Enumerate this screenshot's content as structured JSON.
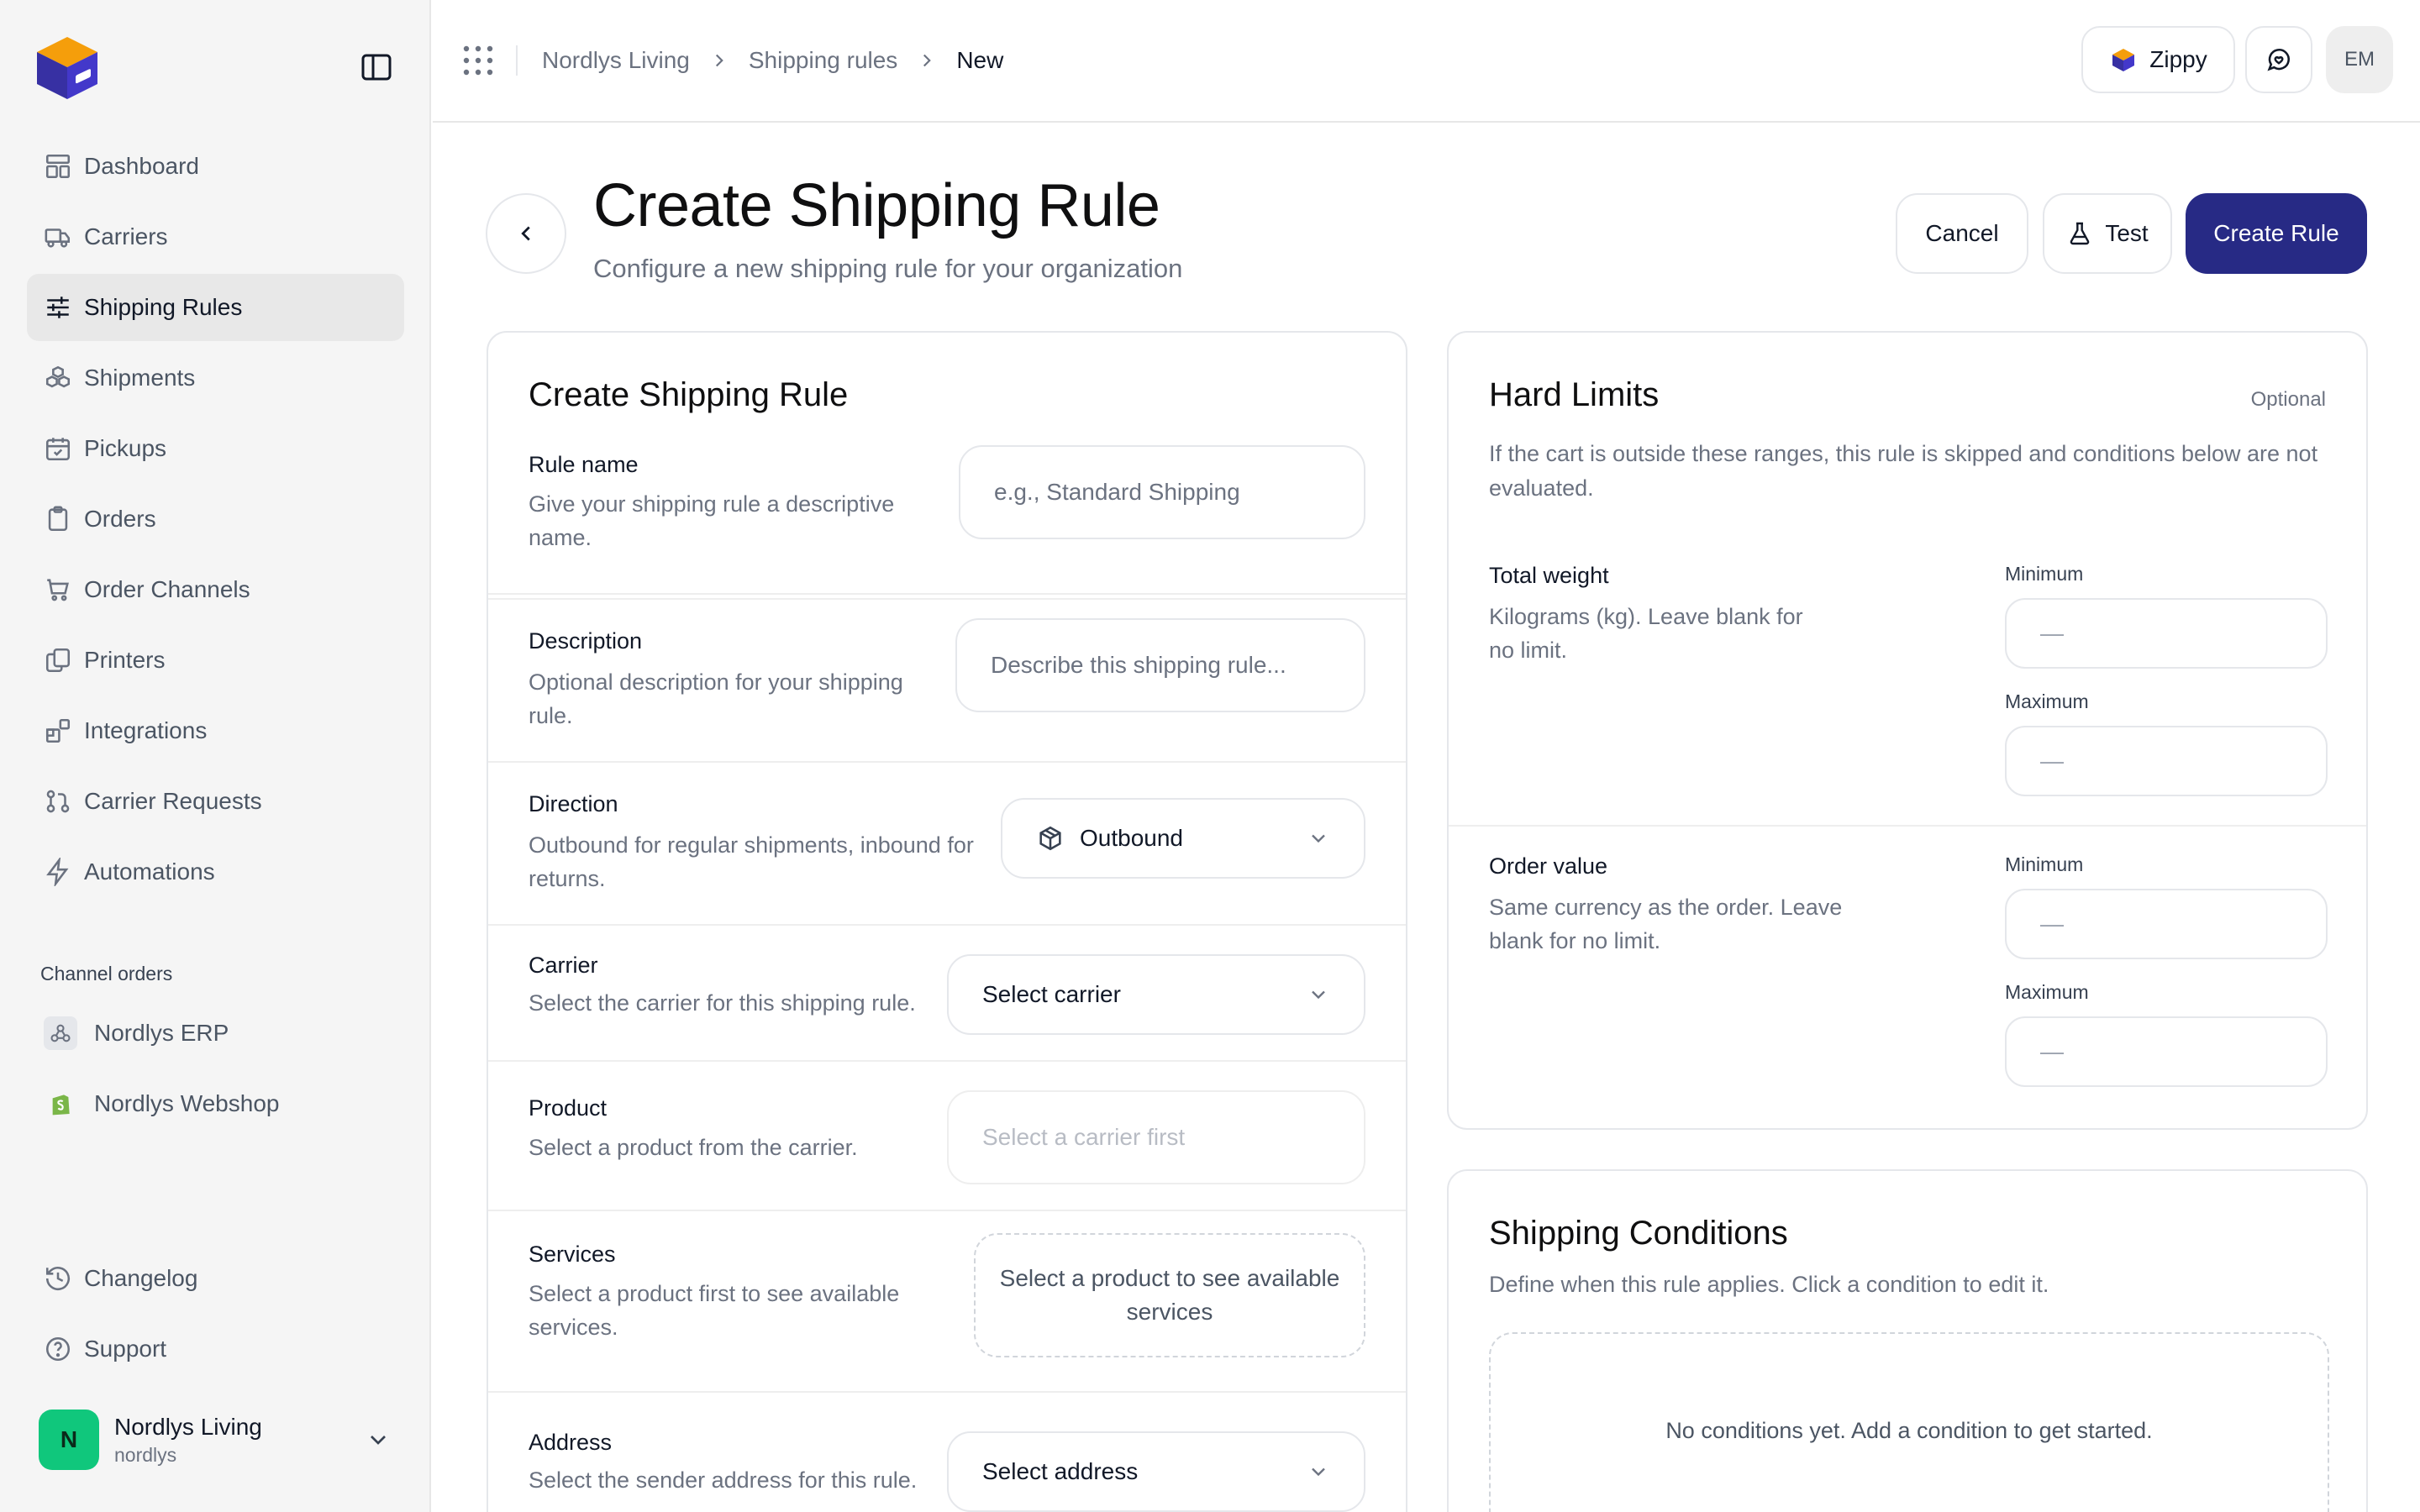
{
  "colors": {
    "primary": "#272a85",
    "sidebar_bg": "#f5f5f5",
    "active_bg": "#e8e8e8",
    "org_avatar": "#10c77c",
    "logo_orange": "#f59e0b",
    "logo_navy": "#3730a3"
  },
  "sidebar": {
    "nav": [
      {
        "label": "Dashboard",
        "icon": "layout-dashboard-icon",
        "active": false
      },
      {
        "label": "Carriers",
        "icon": "truck-icon",
        "active": false
      },
      {
        "label": "Shipping Rules",
        "icon": "sliders-icon",
        "active": true
      },
      {
        "label": "Shipments",
        "icon": "boxes-icon",
        "active": false
      },
      {
        "label": "Pickups",
        "icon": "calendar-check-icon",
        "active": false
      },
      {
        "label": "Orders",
        "icon": "clipboard-icon",
        "active": false
      },
      {
        "label": "Order Channels",
        "icon": "shopping-cart-icon",
        "active": false
      },
      {
        "label": "Printers",
        "icon": "copy-icon",
        "active": false
      },
      {
        "label": "Integrations",
        "icon": "blocks-icon",
        "active": false
      },
      {
        "label": "Carrier Requests",
        "icon": "git-pull-request-icon",
        "active": false
      },
      {
        "label": "Automations",
        "icon": "zap-icon",
        "active": false
      }
    ],
    "channel_section_label": "Channel orders",
    "channels": [
      {
        "label": "Nordlys ERP",
        "icon": "webhook-icon"
      },
      {
        "label": "Nordlys Webshop",
        "icon": "shopify-icon"
      }
    ],
    "bottom": [
      {
        "label": "Changelog",
        "icon": "history-icon"
      },
      {
        "label": "Support",
        "icon": "help-circle-icon"
      }
    ],
    "org": {
      "initial": "N",
      "name": "Nordlys Living",
      "slug": "nordlys"
    }
  },
  "topbar": {
    "breadcrumb": [
      "Nordlys Living",
      "Shipping rules",
      "New"
    ],
    "zippy_label": "Zippy",
    "user_initials": "EM"
  },
  "header": {
    "title": "Create Shipping Rule",
    "subtitle": "Configure a new shipping rule for your organization",
    "cancel_label": "Cancel",
    "test_label": "Test",
    "create_label": "Create Rule"
  },
  "form": {
    "title": "Create Shipping Rule",
    "rule_name": {
      "label": "Rule name",
      "desc": "Give your shipping rule a descriptive name.",
      "placeholder": "e.g., Standard Shipping"
    },
    "description": {
      "label": "Description",
      "desc": "Optional description for your shipping rule.",
      "placeholder": "Describe this shipping rule..."
    },
    "direction": {
      "label": "Direction",
      "desc": "Outbound for regular shipments, inbound for returns.",
      "value": "Outbound"
    },
    "carrier": {
      "label": "Carrier",
      "desc": "Select the carrier for this shipping rule.",
      "placeholder": "Select carrier"
    },
    "product": {
      "label": "Product",
      "desc": "Select a product from the carrier.",
      "placeholder": "Select a carrier first"
    },
    "services": {
      "label": "Services",
      "desc": "Select a product first to see available services.",
      "placeholder": "Select a product to see available services"
    },
    "address": {
      "label": "Address",
      "desc": "Select the sender address for this rule.",
      "placeholder": "Select address"
    }
  },
  "limits": {
    "title": "Hard Limits",
    "optional": "Optional",
    "desc": "If the cart is outside these ranges, this rule is skipped and conditions below are not evaluated.",
    "weight": {
      "label": "Total weight",
      "desc": "Kilograms (kg). Leave blank for no limit.",
      "min_label": "Minimum",
      "max_label": "Maximum",
      "min_placeholder": "—",
      "max_placeholder": "—"
    },
    "order_value": {
      "label": "Order value",
      "desc": "Same currency as the order. Leave blank for no limit.",
      "min_label": "Minimum",
      "max_label": "Maximum",
      "min_placeholder": "—",
      "max_placeholder": "—"
    }
  },
  "conditions": {
    "title": "Shipping Conditions",
    "desc": "Define when this rule applies. Click a condition to edit it.",
    "empty": "No conditions yet. Add a condition to get started."
  }
}
